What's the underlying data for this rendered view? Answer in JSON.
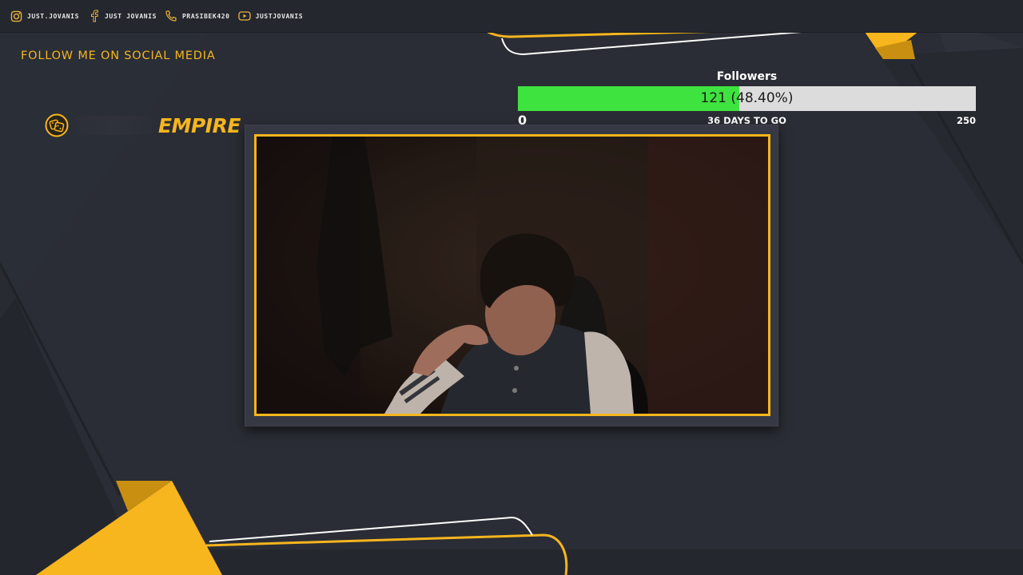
{
  "social": {
    "items": [
      {
        "icon": "instagram-icon",
        "label": "JUST.JOVANIS"
      },
      {
        "icon": "facebook-icon",
        "label": "JUST JOVANIS"
      },
      {
        "icon": "phone-icon",
        "label": "PRASIBEK420"
      },
      {
        "icon": "youtube-icon",
        "label": "JUSTJOVANIS"
      }
    ]
  },
  "follow_heading": "FOLLOW ME ON SOCIAL MEDIA",
  "logo": {
    "text": "EMPIRE"
  },
  "goal": {
    "title": "Followers",
    "current": 121,
    "percent_text": "121 (48.40%)",
    "fraction": 0.484,
    "min": "0",
    "max": "250",
    "days_left": "36 DAYS TO GO"
  },
  "colors": {
    "accent": "#f7b51e",
    "background": "#2a2d35",
    "panel": "#24272e",
    "goal_fill": "#3fe33f",
    "goal_track": "#dcdcdc"
  }
}
